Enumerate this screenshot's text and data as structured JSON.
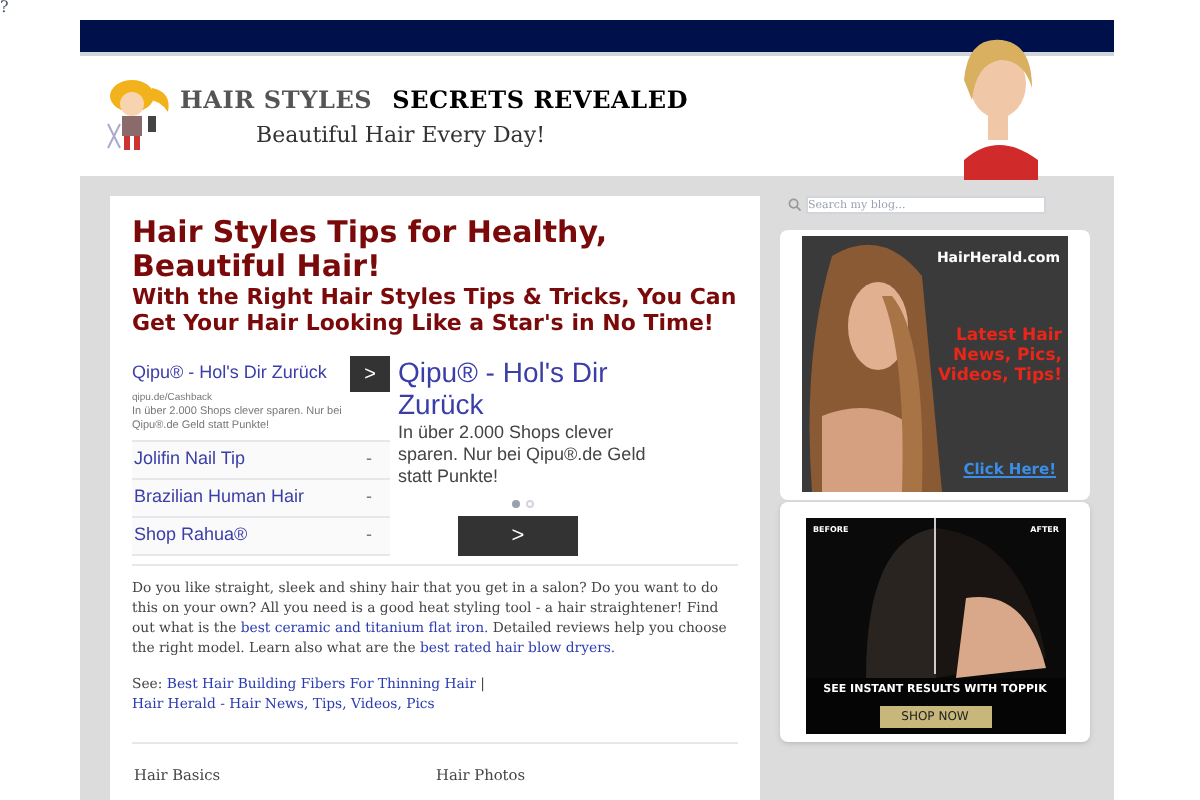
{
  "corner_mark": "?",
  "header": {
    "title_light": "HAIR STYLES",
    "title_dark": "SECRETS REVEALED",
    "tagline": "Beautiful Hair Every Day!"
  },
  "main": {
    "title": "Hair Styles Tips for Healthy, Beautiful Hair!",
    "subtitle": "With the Right Hair Styles Tips & Tricks, You Can Get Your Hair Looking Like a Star's in No Time!",
    "ad_left": {
      "headline": "Qipu® - Hol's Dir Zurück",
      "url": "qipu.de/Cashback",
      "text": "In über 2.000 Shops clever sparen. Nur bei Qipu®.de Geld statt Punkte!",
      "arrow": ">",
      "links": [
        {
          "label": "Jolifin Nail Tip",
          "marker": "-"
        },
        {
          "label": "Brazilian Human Hair",
          "marker": "-"
        },
        {
          "label": "Shop Rahua®",
          "marker": "-"
        }
      ]
    },
    "ad_right": {
      "headline": "Qipu® - Hol's Dir Zurück",
      "text": "In über 2.000 Shops clever sparen. Nur bei Qipu®.de Geld statt Punkte!",
      "dots": [
        {
          "selected": true
        },
        {
          "selected": false
        }
      ],
      "arrow": ">"
    },
    "paragraph": [
      {
        "kind": "text",
        "text": "Do you like straight, sleek and shiny hair that you get in a salon? Do you want to do this on your own? All you need is a good heat styling tool - a hair straightener! Find out what is the "
      },
      {
        "kind": "link",
        "text": "best ceramic and titanium flat iron."
      },
      {
        "kind": "text",
        "text": " Detailed reviews help you choose the right model. Learn also what are the "
      },
      {
        "kind": "link",
        "text": "best rated hair blow dryers."
      }
    ],
    "see": [
      {
        "kind": "text",
        "text": "See: "
      },
      {
        "kind": "link",
        "text": "Best Hair Building Fibers For Thinning Hair"
      },
      {
        "kind": "text",
        "text": " | "
      },
      {
        "kind": "link",
        "text": "Hair Herald - Hair News, Tips, Videos, Pics"
      }
    ],
    "footer_columns": [
      "Hair Basics",
      "Hair Photos"
    ]
  },
  "sidebar": {
    "search": {
      "placeholder": "Search my blog..."
    },
    "ad_1": {
      "site": "HairHerald.com",
      "headline": "Latest Hair News, Pics, Videos, Tips!",
      "cta": "Click Here!"
    },
    "ad_2": {
      "before": "BEFORE",
      "after": "AFTER",
      "headline": "SEE INSTANT RESULTS WITH TOPPIK",
      "cta": "SHOP NOW"
    }
  }
}
